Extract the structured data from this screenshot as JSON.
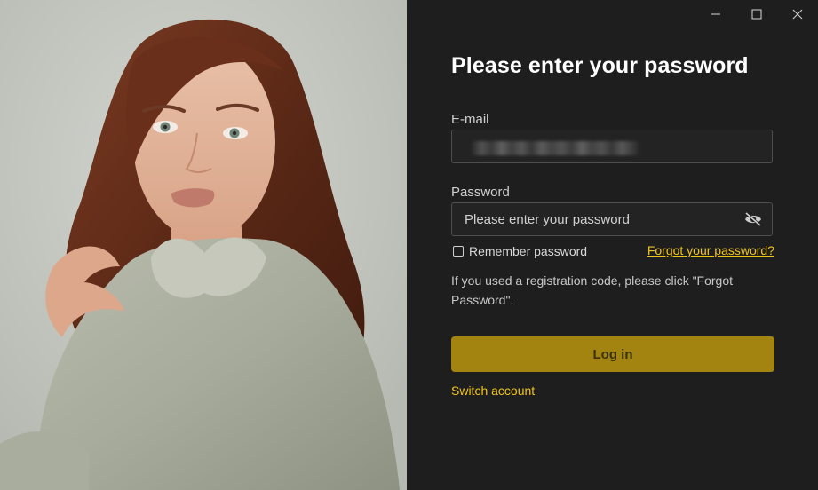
{
  "window_controls": {
    "minimize_icon": "minimize-icon",
    "maximize_icon": "maximize-icon",
    "close_icon": "close-icon"
  },
  "login": {
    "title": "Please enter your password",
    "email_label": "E-mail",
    "email_value": "",
    "password_label": "Password",
    "password_placeholder": "Please enter your password",
    "toggle_visibility_icon": "eye-off-icon",
    "remember_label": "Remember password",
    "remember_checked": false,
    "forgot_link": "Forgot your password?",
    "hint": "If you used a registration code, please click \"Forgot Password\".",
    "login_button": "Log in",
    "switch_account": "Switch account"
  },
  "colors": {
    "background": "#1e1e1e",
    "accent": "#f0c419",
    "button": "#a38410"
  }
}
